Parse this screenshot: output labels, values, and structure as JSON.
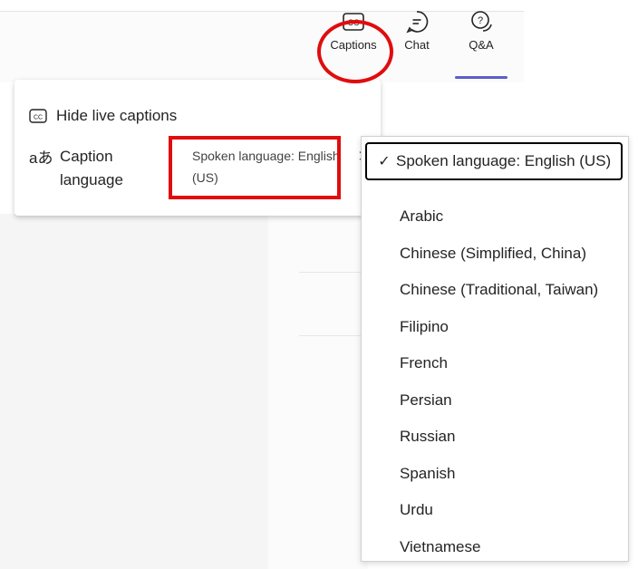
{
  "toolbar": {
    "captions_label": "Captions",
    "chat_label": "Chat",
    "qa_label": "Q&A"
  },
  "menu": {
    "hide_captions": "Hide live captions",
    "caption_language_label": "Caption language",
    "caption_language_value": "Spoken language: English (US)"
  },
  "dropdown": {
    "selected": "Spoken language: English (US)",
    "options": [
      "Arabic",
      "Chinese (Simplified, China)",
      "Chinese (Traditional, Taiwan)",
      "Filipino",
      "French",
      "Persian",
      "Russian",
      "Spanish",
      "Urdu",
      "Vietnamese"
    ]
  },
  "colors": {
    "accent": "#5b5fc7",
    "annotation": "#e00d0d"
  }
}
